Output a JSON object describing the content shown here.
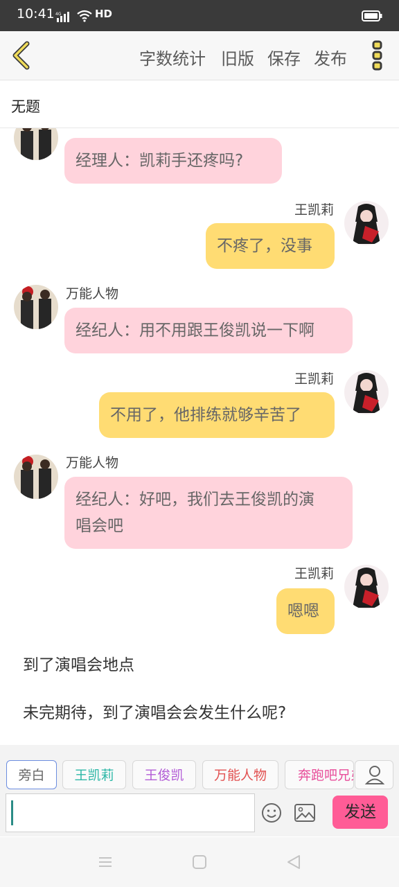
{
  "status_bar": {
    "time": "10:41",
    "network": "4G",
    "hd": "HD"
  },
  "toolbar": {
    "stats_label": "字数统计",
    "old_label": "旧版",
    "save_label": "保存",
    "publish_label": "发布"
  },
  "document": {
    "title": "无题"
  },
  "messages": [
    {
      "side": "left",
      "sender": "",
      "text": "经理人：凯莉手还疼吗?"
    },
    {
      "side": "right",
      "sender": "王凯莉",
      "text": "不疼了，没事"
    },
    {
      "side": "left",
      "sender": "万能人物",
      "text": "经纪人：用不用跟王俊凯说一下啊"
    },
    {
      "side": "right",
      "sender": "王凯莉",
      "text": "不用了，他排练就够辛苦了"
    },
    {
      "side": "left",
      "sender": "万能人物",
      "text_line1": "经纪人：好吧，我们去王俊凯的演",
      "text_line2": "唱会吧"
    },
    {
      "side": "right",
      "sender": "王凯莉",
      "text": "嗯嗯"
    }
  ],
  "narrations": [
    "到了演唱会地点",
    "未完期待，到了演唱会会发生什么呢?"
  ],
  "characters": [
    {
      "label": "旁白",
      "color": "#666666"
    },
    {
      "label": "王凯莉",
      "color": "#2bb7a6"
    },
    {
      "label": "王俊凯",
      "color": "#b25bd6"
    },
    {
      "label": "万能人物",
      "color": "#e25151"
    },
    {
      "label": "奔跑吧兄弟",
      "color": "#e84f9b"
    }
  ],
  "composer": {
    "value": "",
    "send_label": "发送"
  },
  "colors": {
    "pink_bubble": "#ffd3dc",
    "yellow_bubble": "#ffdc73",
    "send_button": "#ff5c96",
    "toolbar_icon": "#e8d44a"
  },
  "icons": {
    "back": "chevron-left-icon",
    "more": "more-vertical-icon",
    "user": "user-icon",
    "emoji": "smiley-icon",
    "image": "image-icon"
  }
}
